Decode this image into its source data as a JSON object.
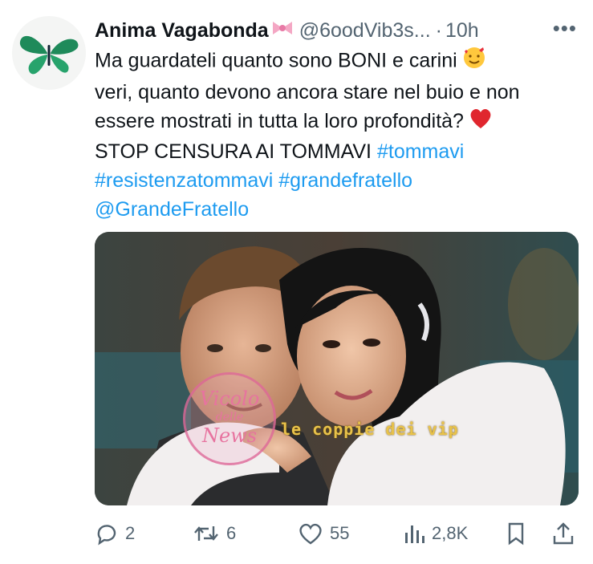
{
  "author": {
    "name": "Anima Vagabonda",
    "handle": "@6oodVib3s...",
    "separator": "·",
    "time": "10h"
  },
  "tweet": {
    "line1_text": "Ma guardateli quanto sono BONI e carini",
    "line2_text": "veri, quanto devono ancora stare nel buio e non",
    "line3_text": "essere mostrati in tutta la loro profondità?",
    "line4_text": "STOP CENSURA AI TOMMAVI",
    "hashtag1": "#tommavi",
    "hashtag2": "#resistenzatommavi",
    "hashtag3": "#grandefratello",
    "mention": "@GrandeFratello"
  },
  "watermarks": {
    "left_line1": "Vicolo",
    "left_line2": "delle",
    "left_line3": "News",
    "right": "le coppie dei vip"
  },
  "actions": {
    "replies": "2",
    "retweets": "6",
    "likes": "55",
    "views": "2,8K"
  },
  "icons": {
    "avatar": "butterfly-icon",
    "name_badge": "ribbon-bow-icon",
    "more": "more-icon",
    "reply": "reply-icon",
    "retweet": "retweet-icon",
    "like": "heart-icon",
    "views": "views-icon",
    "bookmark": "bookmark-icon",
    "share": "share-icon"
  },
  "colors": {
    "link": "#1d9bf0",
    "text": "#0f1419",
    "secondary": "#536471"
  }
}
